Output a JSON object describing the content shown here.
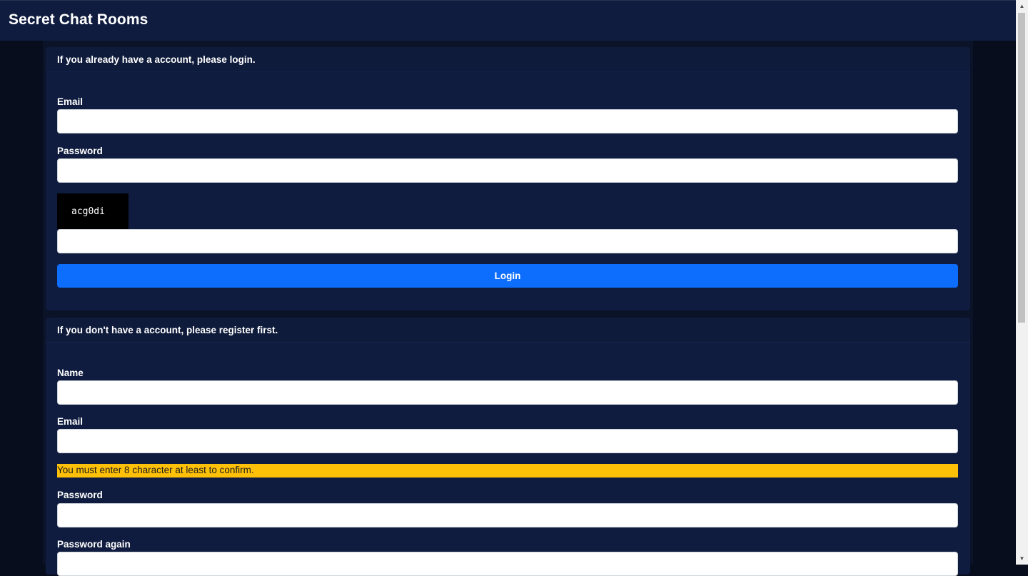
{
  "app": {
    "title": "Secret Chat Rooms"
  },
  "login": {
    "header": "If you already have a account, please login.",
    "email_label": "Email",
    "email_value": "",
    "password_label": "Password",
    "password_value": "",
    "captcha_text": "acg0di",
    "captcha_value": "",
    "submit_label": "Login"
  },
  "register": {
    "header": "If you don't have a account, please register first.",
    "name_label": "Name",
    "name_value": "",
    "email_label": "Email",
    "email_value": "",
    "warning": "You must enter 8 character at least to confirm.",
    "password_label": "Password",
    "password_value": "",
    "password_again_label": "Password again",
    "password_again_value": ""
  },
  "scrollbar": {
    "up_icon": "▲",
    "down_icon": "▼"
  },
  "colors": {
    "navbar": "#0f1c3f",
    "card": "#0f1c3f",
    "page_bg": "#080d1d",
    "primary_button": "#0d6efd",
    "warning": "#ffc107"
  }
}
